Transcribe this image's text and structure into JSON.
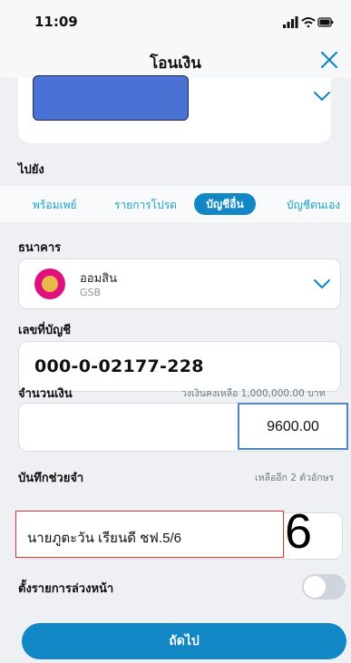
{
  "status_bar": {
    "time": "11:09"
  },
  "header": {
    "title": "โอนเงิน",
    "close_icon": "close-icon"
  },
  "to_section": {
    "label": "ไปยัง"
  },
  "tabs": [
    {
      "label": "พร้อมเพย์",
      "active": false
    },
    {
      "label": "รายการโปรด",
      "active": false
    },
    {
      "label": "บัญชีอื่น",
      "active": true
    },
    {
      "label": "บัญชีตนเอง",
      "active": false
    }
  ],
  "bank": {
    "label": "ธนาคาร",
    "name": "ออมสิน",
    "code": "GSB",
    "logo_color": "#e0117d"
  },
  "account": {
    "label": "เลขที่บัญชี",
    "number": "000-0-02177-228"
  },
  "amount": {
    "label": "จำนวนเงิน",
    "limit_note": "วงเงินคงเหลือ 1,000,000.00 บาท",
    "value": "9600.00"
  },
  "memo": {
    "label": "บันทึกช่วยจำ",
    "remaining_note": "เหลืออีก 2 ตัวอักษร",
    "value": "นายภูตะวัน เรียนดี ชฟ.5/6",
    "annotation": "6"
  },
  "schedule": {
    "label": "ตั้งรายการล่วงหน้า",
    "enabled": false
  },
  "next_button": {
    "label": "ถัดไป"
  },
  "colors": {
    "accent": "#1287c5",
    "tab_text": "#1aa0c8",
    "redaction": "#4a72d4",
    "amount_outline": "#4f86c4",
    "memo_outline": "#e0332f"
  }
}
